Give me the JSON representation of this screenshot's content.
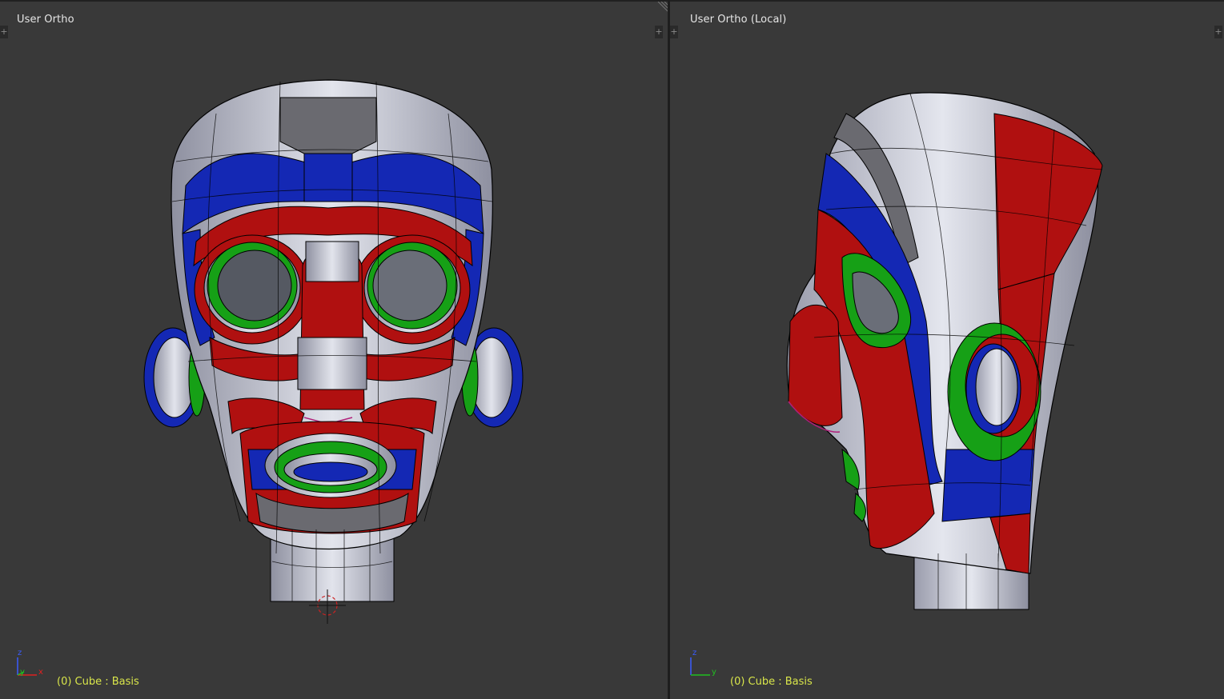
{
  "left_viewport": {
    "title": "User Ortho",
    "status": "(0) Cube : Basis",
    "axes": {
      "z": "z",
      "y": "y",
      "x": "x"
    }
  },
  "right_viewport": {
    "title": "User Ortho (Local)",
    "status": "(0) Cube : Basis",
    "axes": {
      "z": "z",
      "y": "y"
    }
  },
  "colors": {
    "background": "#393939",
    "text": "#e6e6e6",
    "status_text": "#d9e64a",
    "model_red": "#b01010",
    "model_blue": "#1428b4",
    "model_green": "#16a016",
    "model_white": "#c9cbd6",
    "model_gray": "#6a6a70"
  },
  "icons": [
    "plus-icon",
    "corner-handle-icon",
    "axis-gizmo-icon",
    "3d-cursor-icon"
  ]
}
